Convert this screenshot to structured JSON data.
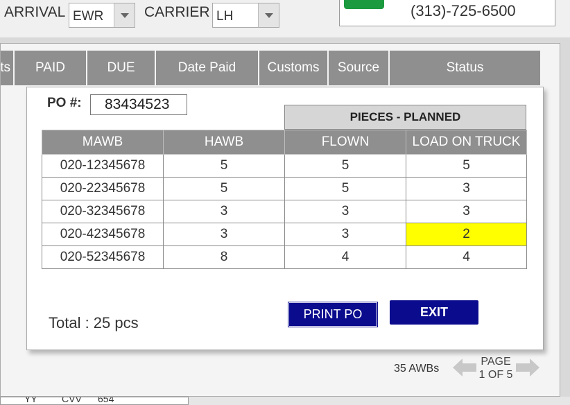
{
  "filters": {
    "arrival_label": "ARRIVAL",
    "arrival_value": "EWR",
    "carrier_label": "CARRIER",
    "carrier_value": "LH"
  },
  "contact": {
    "phone": "(313)-725-6500"
  },
  "columns": [
    "ts",
    "PAID",
    "DUE",
    "Date Paid",
    "Customs",
    "Source",
    "Status"
  ],
  "modal": {
    "po_label": "PO #:",
    "po_value": "83434523",
    "group_header": "PIECES - PLANNED",
    "table_headers": [
      "MAWB",
      "HAWB",
      "FLOWN",
      "LOAD ON TRUCK"
    ],
    "rows": [
      {
        "mawb": "020-12345678",
        "hawb": "5",
        "flown": "5",
        "truck": "5",
        "highlight": false
      },
      {
        "mawb": "020-22345678",
        "hawb": "5",
        "flown": "5",
        "truck": "3",
        "highlight": false
      },
      {
        "mawb": "020-32345678",
        "hawb": "3",
        "flown": "3",
        "truck": "3",
        "highlight": false
      },
      {
        "mawb": "020-42345678",
        "hawb": "3",
        "flown": "3",
        "truck": "2",
        "highlight": true
      },
      {
        "mawb": "020-52345678",
        "hawb": "8",
        "flown": "4",
        "truck": "4",
        "highlight": false
      }
    ],
    "total": "Total : 25 pcs",
    "print_label": "PRINT PO",
    "exit_label": "EXIT"
  },
  "pager": {
    "awb_count": "35 AWBs",
    "page_label": "PAGE",
    "page_value": "1 OF 5"
  },
  "bottom_fragment": [
    "YY",
    "CVV",
    "654"
  ],
  "colors": {
    "header_gray": "#8f8f8f",
    "button_blue": "#0b0b8e",
    "highlight_yellow": "#ffff00",
    "green": "#1b9a3f"
  }
}
